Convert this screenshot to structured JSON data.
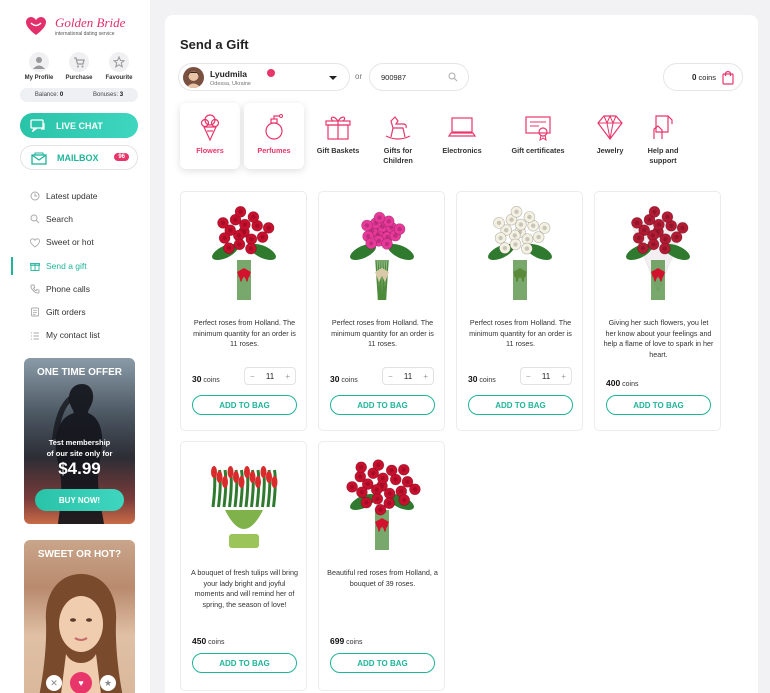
{
  "brand": {
    "name": "Golden Bride",
    "tagline": "international dating service"
  },
  "quick_links": [
    {
      "label": "My Profile",
      "icon": "user-avatar-icon"
    },
    {
      "label": "Purchase",
      "icon": "cart-icon"
    },
    {
      "label": "Favourite",
      "icon": "star-icon"
    }
  ],
  "balance": {
    "balance_label": "Balance:",
    "balance_value": "0",
    "bonuses_label": "Bonuses:",
    "bonuses_value": "3"
  },
  "live_chat": {
    "label": "LIVE CHAT"
  },
  "mailbox": {
    "label": "MAILBOX",
    "count": "96"
  },
  "menu": [
    {
      "label": "Latest update",
      "icon": "clock-icon"
    },
    {
      "label": "Search",
      "icon": "search-icon"
    },
    {
      "label": "Sweet or hot",
      "icon": "heart-icon"
    },
    {
      "label": "Send a gift",
      "icon": "gift-icon",
      "active": true
    },
    {
      "label": "Phone calls",
      "icon": "phone-icon"
    },
    {
      "label": "Gift orders",
      "icon": "gift-orders-icon"
    },
    {
      "label": "My contact list",
      "icon": "list-icon"
    }
  ],
  "promo_offer": {
    "title": "ONE TIME OFFER",
    "text_line1": "Test membership",
    "text_line2": "of our site only for",
    "price": "$4.99",
    "button": "BUY NOW!"
  },
  "promo_sweet": {
    "title": "SWEET OR HOT?"
  },
  "page": {
    "title": "Send a Gift",
    "or_label": "or"
  },
  "user_select": {
    "name": "Lyudmila",
    "location": "Odessa, Ukraine"
  },
  "id_search": {
    "value": "900987"
  },
  "coins": {
    "value": "0",
    "unit": "coins"
  },
  "categories": [
    {
      "label": "Flowers",
      "icon": "flowers-icon",
      "selected": true
    },
    {
      "label": "Perfumes",
      "icon": "perfume-icon",
      "selected": true
    },
    {
      "label": "Gift Baskets",
      "icon": "gift-basket-icon"
    },
    {
      "label": "Gifts for Children",
      "icon": "rocking-horse-icon"
    },
    {
      "label": "Electronics",
      "icon": "laptop-icon"
    },
    {
      "label": "Gift certificates",
      "icon": "certificate-icon"
    },
    {
      "label": "Jewelry",
      "icon": "diamond-icon"
    },
    {
      "label": "Help and support",
      "icon": "help-hand-icon"
    }
  ],
  "products": [
    {
      "desc": "Perfect roses from Holland. The minimum quantity for an order is 11 roses.",
      "price": "30",
      "unit": "coins",
      "qty": "11",
      "minus": "−",
      "plus": "+",
      "button": "ADD TO BAG",
      "color": "#c8102e"
    },
    {
      "desc": "Perfect roses from Holland. The minimum quantity for an order is 11 roses.",
      "price": "30",
      "unit": "coins",
      "qty": "11",
      "minus": "−",
      "plus": "+",
      "button": "ADD TO BAG",
      "color": "#e8399a"
    },
    {
      "desc": "Perfect roses from Holland. The minimum quantity for an order is 11 roses.",
      "price": "30",
      "unit": "coins",
      "qty": "11",
      "minus": "−",
      "plus": "+",
      "button": "ADD TO BAG",
      "color": "#f4f1e2"
    },
    {
      "desc": "Giving her such flowers, you let her know about your feelings and help a flame of love to spark in her heart.",
      "price": "400",
      "unit": "coins",
      "button": "ADD TO BAG",
      "color": "#b31b34"
    },
    {
      "desc": "A bouquet of fresh tulips will bring your lady bright and joyful moments and will remind her of spring, the season of love!",
      "price": "450",
      "unit": "coins",
      "button": "ADD TO BAG",
      "color": "#d92b2b"
    },
    {
      "desc": "Beautiful red roses from Holland, a bouquet of 39 roses.",
      "price": "699",
      "unit": "coins",
      "button": "ADD TO BAG",
      "color": "#c8102e"
    }
  ]
}
